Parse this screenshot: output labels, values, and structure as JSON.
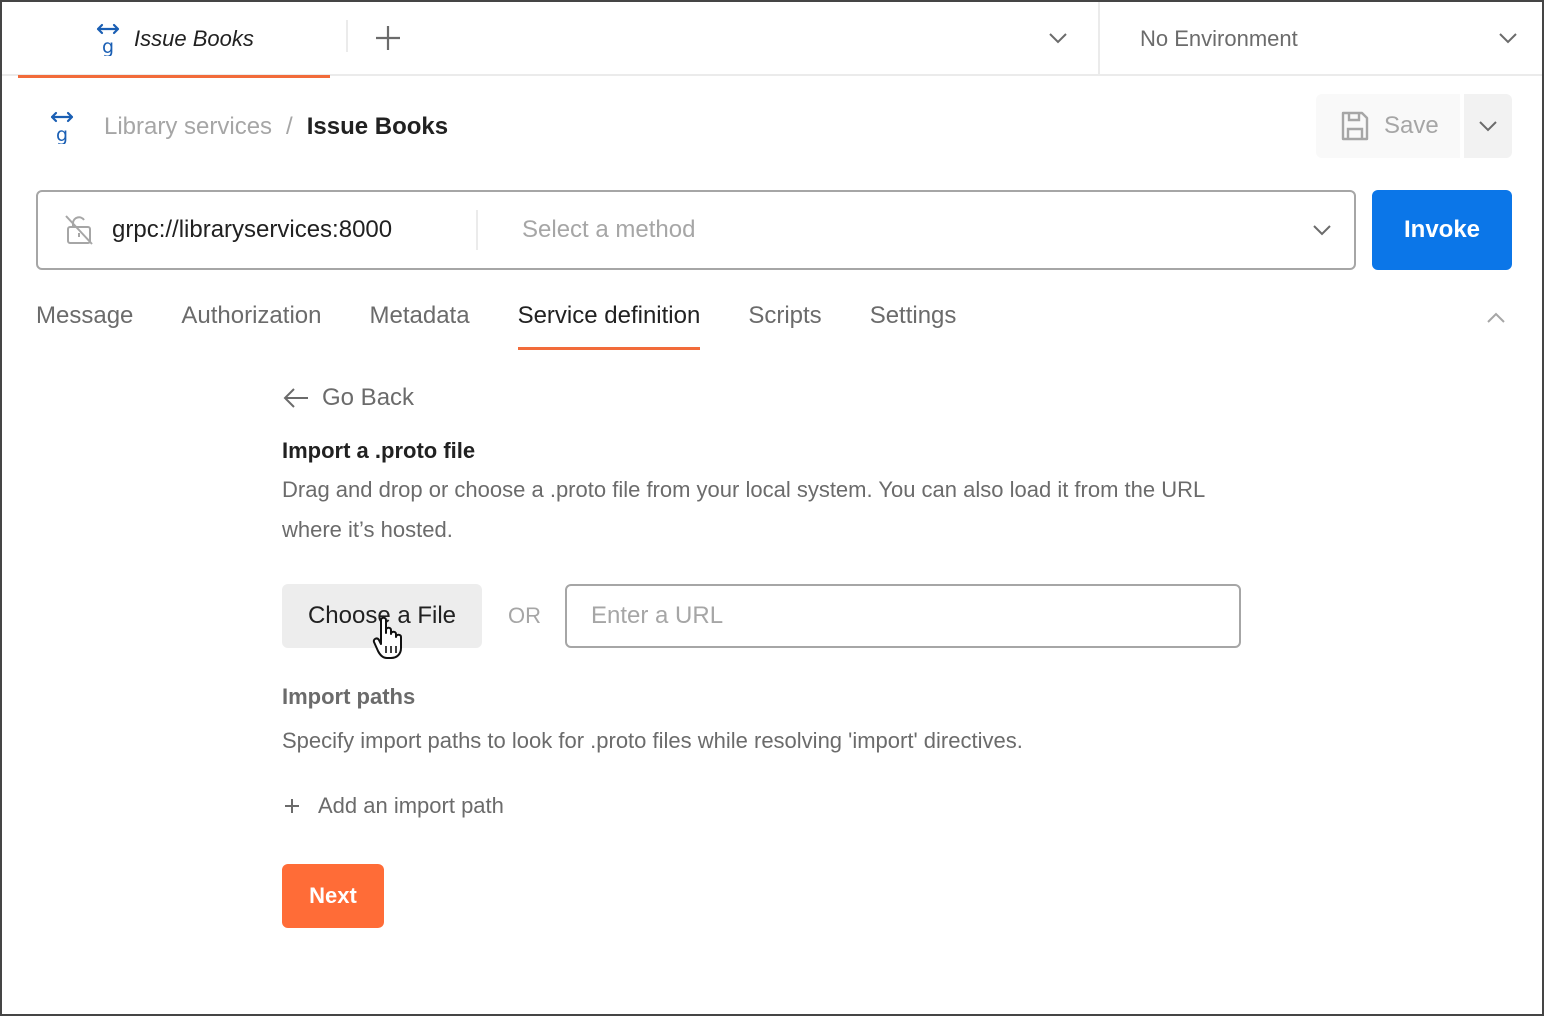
{
  "tabbar": {
    "active_tab": {
      "title": "Issue Books",
      "icon": "grpc-icon"
    },
    "new_tab_icon": "plus-icon",
    "tabs_dropdown_icon": "chevron-down-icon",
    "environment": {
      "selected": "No Environment",
      "icon": "chevron-down-icon"
    }
  },
  "breadcrumb": {
    "icon": "grpc-icon",
    "parent": "Library services",
    "separator": "/",
    "current": "Issue Books"
  },
  "save": {
    "label": "Save",
    "icon": "save-icon",
    "more_icon": "chevron-down-icon"
  },
  "request": {
    "lock_icon": "lock-off-icon",
    "url": "grpc://libraryservices:8000",
    "method_placeholder": "Select a method",
    "invoke_label": "Invoke"
  },
  "subtabs": {
    "items": [
      {
        "label": "Message",
        "active": false
      },
      {
        "label": "Authorization",
        "active": false
      },
      {
        "label": "Metadata",
        "active": false
      },
      {
        "label": "Service definition",
        "active": true
      },
      {
        "label": "Scripts",
        "active": false
      },
      {
        "label": "Settings",
        "active": false
      }
    ],
    "collapse_icon": "chevron-up-icon"
  },
  "service_definition": {
    "go_back": "Go Back",
    "import_title": "Import a .proto file",
    "import_desc": "Drag and drop or choose a .proto file from your local system. You can also load it from the URL where it’s hosted.",
    "choose_file_label": "Choose a File",
    "or_label": "OR",
    "url_placeholder": "Enter a URL",
    "url_value": "",
    "paths_title": "Import paths",
    "paths_desc": "Specify import paths to look for .proto files while resolving 'import' directives.",
    "add_path_label": "Add an import path",
    "next_label": "Next"
  },
  "colors": {
    "accent_orange": "#ff6c37",
    "tab_underline": "#f26b3a",
    "invoke_blue": "#0b76e8",
    "grpc_blue": "#1a5fb4"
  }
}
